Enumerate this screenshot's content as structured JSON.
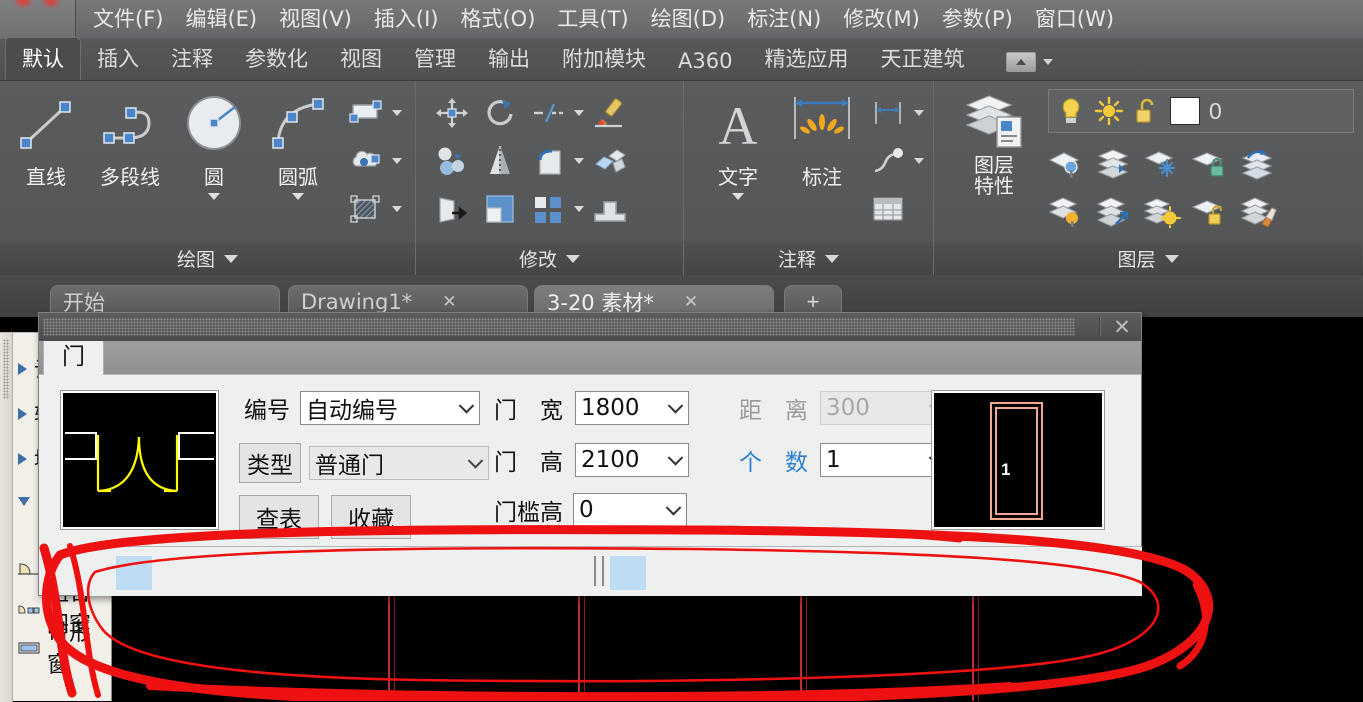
{
  "menubar": {
    "items": [
      "文件(F)",
      "编辑(E)",
      "视图(V)",
      "插入(I)",
      "格式(O)",
      "工具(T)",
      "绘图(D)",
      "标注(N)",
      "修改(M)",
      "参数(P)",
      "窗口(W)"
    ]
  },
  "ribbon_tabs": {
    "items": [
      "默认",
      "插入",
      "注释",
      "参数化",
      "视图",
      "管理",
      "输出",
      "附加模块",
      "A360",
      "精选应用",
      "天正建筑"
    ],
    "active": "默认"
  },
  "ribbon": {
    "panels": [
      {
        "title": "绘图",
        "big": [
          {
            "label": "直线",
            "icon": "line-icon",
            "caret": false
          },
          {
            "label": "多段线",
            "icon": "polyline-icon",
            "caret": false
          },
          {
            "label": "圆",
            "icon": "circle-icon",
            "caret": true
          },
          {
            "label": "圆弧",
            "icon": "arc-icon",
            "caret": true
          }
        ],
        "small": [
          {
            "icon": "rectangle-icon",
            "caret": true
          },
          {
            "icon": "cloud-revision-icon",
            "caret": true
          },
          {
            "icon": "hatch-icon",
            "caret": true
          }
        ]
      },
      {
        "title": "修改",
        "small": [
          {
            "icon": "move-icon",
            "caret": false
          },
          {
            "icon": "rotate-icon",
            "caret": false
          },
          {
            "icon": "trim-icon",
            "caret": true
          },
          {
            "icon": "paintbrush-icon",
            "caret": false
          },
          {
            "icon": "copy-icon",
            "caret": false
          },
          {
            "icon": "mirror-icon",
            "caret": false
          },
          {
            "icon": "fillet-icon",
            "caret": true
          },
          {
            "icon": "explode-icon",
            "caret": false
          },
          {
            "icon": "stretch-icon",
            "caret": false
          },
          {
            "icon": "scale-icon",
            "caret": false
          },
          {
            "icon": "array-icon",
            "caret": true
          },
          {
            "icon": "extrude-icon",
            "caret": false
          }
        ]
      },
      {
        "title": "注释",
        "big": [
          {
            "label": "文字",
            "icon": "text-icon",
            "caret": true
          },
          {
            "label": "标注",
            "icon": "dimension-icon",
            "caret": false
          }
        ],
        "small": [
          {
            "icon": "linear-dimension-icon",
            "caret": true
          },
          {
            "icon": "leader-icon",
            "caret": true
          },
          {
            "icon": "table-icon",
            "caret": false
          }
        ]
      },
      {
        "title": "图层",
        "big": [
          {
            "label_line1": "图层",
            "label_line2": "特性",
            "icon": "layer-properties-icon",
            "caret": false
          }
        ],
        "layer_status": {
          "layer_name": "0",
          "icons": [
            "lightbulb-icon",
            "sun-icon",
            "unlock-icon"
          ],
          "color_swatch": "#ffffff"
        },
        "small": [
          {
            "icon": "layer-isolate-icon"
          },
          {
            "icon": "layer-merge-icon"
          },
          {
            "icon": "layer-freeze-icon"
          },
          {
            "icon": "layer-lock-icon"
          },
          {
            "icon": "layer-previous-icon"
          },
          {
            "icon": "layer-off-icon"
          },
          {
            "icon": "layer-change-icon"
          },
          {
            "icon": "layer-unisolate-icon"
          },
          {
            "icon": "layer-unlock-icon"
          },
          {
            "icon": "layer-match-icon"
          }
        ]
      }
    ]
  },
  "doc_tabs": {
    "items": [
      {
        "label": "开始",
        "closable": false,
        "active": false
      },
      {
        "label": "Drawing1*",
        "closable": true,
        "active": false
      },
      {
        "label": "3-20 素材*",
        "closable": true,
        "active": true
      }
    ],
    "add_label": "+"
  },
  "palette": {
    "nodes": [
      "设",
      "轴",
      "墙"
    ],
    "expanded_node": "",
    "leaves": [
      "门窗",
      "组合门窗",
      "带形窗"
    ]
  },
  "dialog": {
    "tab_label": "门",
    "close_label": "✕",
    "form": {
      "number_label": "编号",
      "number_value": "自动编号",
      "type_button_label": "类型",
      "type_value": "普通门",
      "lookup_button_label": "查表",
      "favorite_button_label": "收藏",
      "door_width_label": "门　宽",
      "door_width_value": "1800",
      "door_height_label": "门　高",
      "door_height_value": "2100",
      "threshold_label": "门槛高",
      "threshold_value": "0",
      "distance_label": "距　离",
      "distance_value": "300",
      "count_label": "个　数",
      "count_value": "1"
    },
    "preview_left": {
      "name": "door-plan-preview",
      "stroke": "#ffff00",
      "wall": "#ffffff",
      "bg": "#000000"
    },
    "preview_right": {
      "name": "door-elevation-preview",
      "frame": "#f0a090",
      "label": "1",
      "bg": "#000000"
    }
  },
  "bottom_toolbar": {
    "highlight_color": "#bfdcf5",
    "buttons": [
      "button-1",
      "button-2"
    ]
  },
  "annotation": {
    "color": "#ee1111",
    "description": "hand-drawn red ellipse highlighting the bottom strip"
  }
}
